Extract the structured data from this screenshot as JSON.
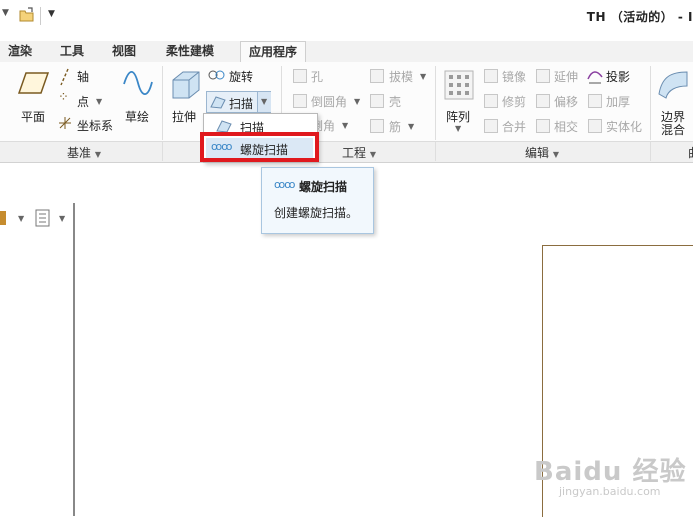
{
  "window": {
    "title": "TH （活动的） - I"
  },
  "tabs": [
    "渲染",
    "工具",
    "视图",
    "柔性建模",
    "应用程序"
  ],
  "ribbon": {
    "datum": {
      "plane": "平面",
      "axis": "轴",
      "point": "点",
      "csys": "坐标系",
      "sketch": "草绘",
      "group": "基准"
    },
    "shapes": {
      "extrude": "拉伸",
      "revolve": "旋转",
      "sweep": "扫描"
    },
    "engineering": {
      "hole": "孔",
      "round": "倒圆角",
      "chamfer": "倒角",
      "draft": "拔模",
      "shell": "壳",
      "rib": "筋",
      "group": "工程"
    },
    "editing": {
      "pattern": "阵列",
      "mirror": "镜像",
      "extend": "延伸",
      "project": "投影",
      "trim": "修剪",
      "offset": "偏移",
      "thicken": "加厚",
      "merge": "合并",
      "intersect": "相交",
      "solidify": "实体化",
      "group": "编辑"
    },
    "surfaces": {
      "boundary_blend_line1": "边界",
      "boundary_blend_line2": "混合",
      "group": "曲"
    }
  },
  "sweep_menu": {
    "items": [
      "扫描",
      "螺旋扫描"
    ]
  },
  "tooltip": {
    "title": "螺旋扫描",
    "description": "创建螺旋扫描。"
  },
  "watermark": {
    "brand": "Baidu 经验",
    "url": "jingyan.baidu.com"
  }
}
